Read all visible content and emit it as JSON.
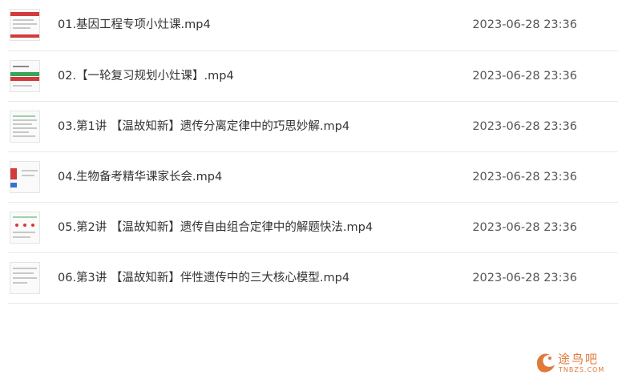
{
  "files": [
    {
      "name": "01.基因工程专项小灶课.mp4",
      "date": "2023-06-28 23:36"
    },
    {
      "name": "02.【一轮复习规划小灶课】.mp4",
      "date": "2023-06-28 23:36"
    },
    {
      "name": "03.第1讲 【温故知新】遗传分离定律中的巧思妙解.mp4",
      "date": "2023-06-28 23:36"
    },
    {
      "name": "04.生物备考精华课家长会.mp4",
      "date": "2023-06-28 23:36"
    },
    {
      "name": "05.第2讲 【温故知新】遗传自由组合定律中的解题快法.mp4",
      "date": "2023-06-28 23:36"
    },
    {
      "name": "06.第3讲 【温故知新】伴性遗传中的三大核心模型.mp4",
      "date": "2023-06-28 23:36"
    }
  ],
  "watermark": {
    "text": "途鸟吧",
    "sub": "TNBZS.COM",
    "icon": "bird-logo-icon",
    "color": "#e07a3a"
  },
  "colors": {
    "accent_red": "#d23b3b",
    "accent_green": "#3aa55a",
    "divider": "#eaeaea"
  }
}
